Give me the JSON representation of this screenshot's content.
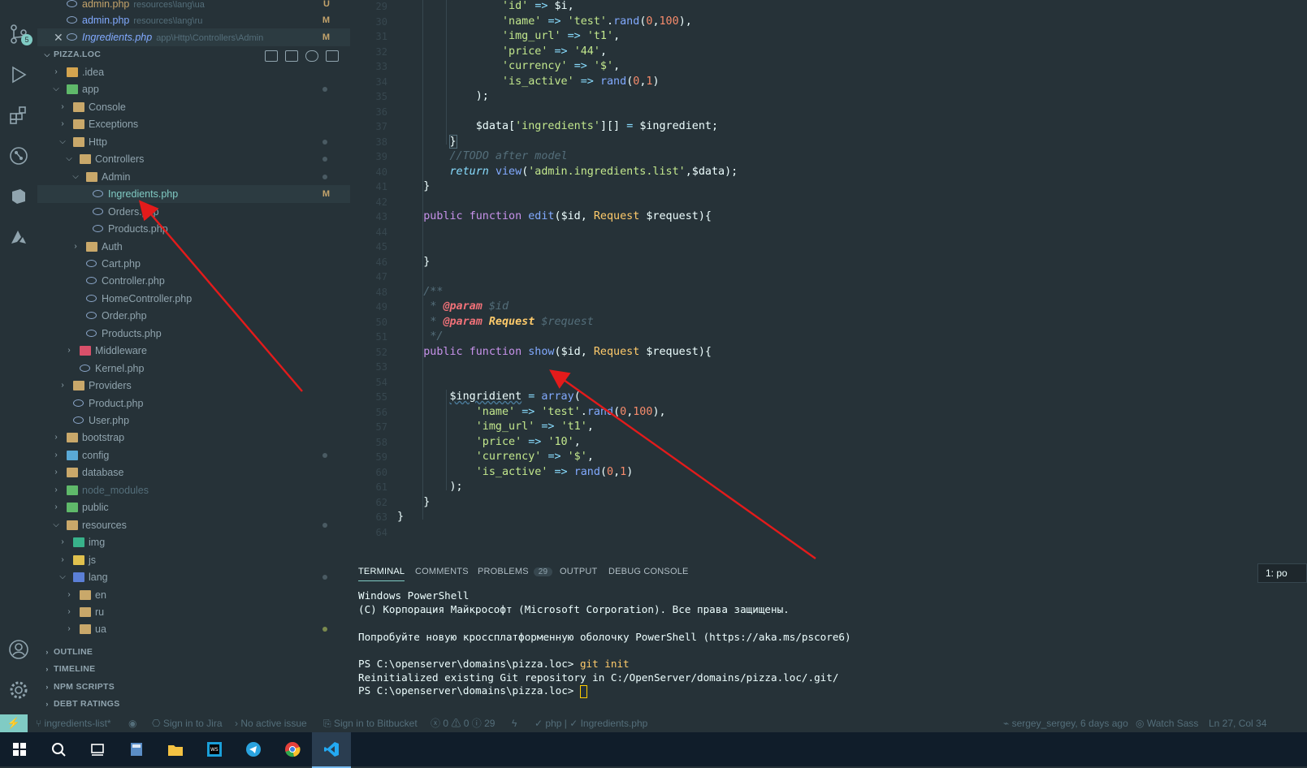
{
  "colors": {
    "accent": "#80cbc4",
    "arrow": "#e31b1b",
    "modified": "#c3a36b"
  },
  "activity_bar": {
    "scm_badge": "5",
    "icons": [
      "source-control-icon",
      "run-debug-icon",
      "extensions-icon",
      "git-graph-icon",
      "remote-explorer-icon",
      "azure-icon",
      "account-icon",
      "settings-gear-icon"
    ]
  },
  "open_editors": [
    {
      "name": "admin.php",
      "path": "resources\\lang\\ua",
      "status": "U"
    },
    {
      "name": "admin.php",
      "path": "resources\\lang\\ru",
      "status": "M"
    },
    {
      "name": "Ingredients.php",
      "path": "app\\Http\\Controllers\\Admin",
      "status": "M"
    }
  ],
  "explorer": {
    "root": "PIZZA.LOC",
    "tree": [
      {
        "label": ".idea"
      },
      {
        "label": "app"
      },
      {
        "label": "Console"
      },
      {
        "label": "Exceptions"
      },
      {
        "label": "Http"
      },
      {
        "label": "Controllers"
      },
      {
        "label": "Admin"
      },
      {
        "label": "Ingredients.php",
        "status": "M"
      },
      {
        "label": "Orders.php"
      },
      {
        "label": "Products.php"
      },
      {
        "label": "Auth"
      },
      {
        "label": "Cart.php"
      },
      {
        "label": "Controller.php"
      },
      {
        "label": "HomeController.php"
      },
      {
        "label": "Order.php"
      },
      {
        "label": "Products.php"
      },
      {
        "label": "Middleware"
      },
      {
        "label": "Kernel.php"
      },
      {
        "label": "Providers"
      },
      {
        "label": "Product.php"
      },
      {
        "label": "User.php"
      },
      {
        "label": "bootstrap"
      },
      {
        "label": "config"
      },
      {
        "label": "database"
      },
      {
        "label": "node_modules"
      },
      {
        "label": "public"
      },
      {
        "label": "resources"
      },
      {
        "label": "img"
      },
      {
        "label": "js"
      },
      {
        "label": "lang"
      },
      {
        "label": "en"
      },
      {
        "label": "ru"
      },
      {
        "label": "ua"
      }
    ],
    "sections": [
      "OUTLINE",
      "TIMELINE",
      "NPM SCRIPTS",
      "DEBT RATINGS"
    ]
  },
  "editor": {
    "line_numbers": [
      "29",
      "30",
      "31",
      "32",
      "33",
      "34",
      "35",
      "36",
      "37",
      "38",
      "39",
      "40",
      "41",
      "42",
      "43",
      "44",
      "45",
      "46",
      "47",
      "48",
      "49",
      "50",
      "51",
      "52",
      "53",
      "54",
      "55",
      "56",
      "57",
      "58",
      "59",
      "60",
      "61",
      "62",
      "63",
      "64"
    ]
  },
  "panel": {
    "tabs": [
      "TERMINAL",
      "COMMENTS",
      "PROBLEMS",
      "OUTPUT",
      "DEBUG CONSOLE"
    ],
    "problems_count": "29",
    "terminal_selector": "1: po",
    "terminal_lines": [
      "Windows PowerShell",
      "(C) Корпорация Майкрософт (Microsoft Corporation). Все права защищены.",
      "",
      "Попробуйте новую кроссплатформенную оболочку PowerShell (https://aka.ms/pscore6)",
      "",
      "PS C:\\openserver\\domains\\pizza.loc> git init",
      "Reinitialized existing Git repository in C:/OpenServer/domains/pizza.loc/.git/",
      "PS C:\\openserver\\domains\\pizza.loc> "
    ]
  },
  "status_bar": {
    "branch": "ingredients-list*",
    "jira": "Sign in to Jira",
    "issue": "No active issue",
    "bitbucket": "Sign in to Bitbucket",
    "errors": "0",
    "warnings": "0",
    "infos": "29",
    "language": "php | ✓ Ingredients.php",
    "blame": "sergey_sergey, 6 days ago",
    "sass": "Watch Sass",
    "position": "Ln 27, Col 34"
  },
  "taskbar": {
    "apps": [
      "windows-start",
      "search",
      "task-view",
      "calculator",
      "file-explorer",
      "webstorm",
      "telegram",
      "chrome",
      "vscode"
    ]
  }
}
